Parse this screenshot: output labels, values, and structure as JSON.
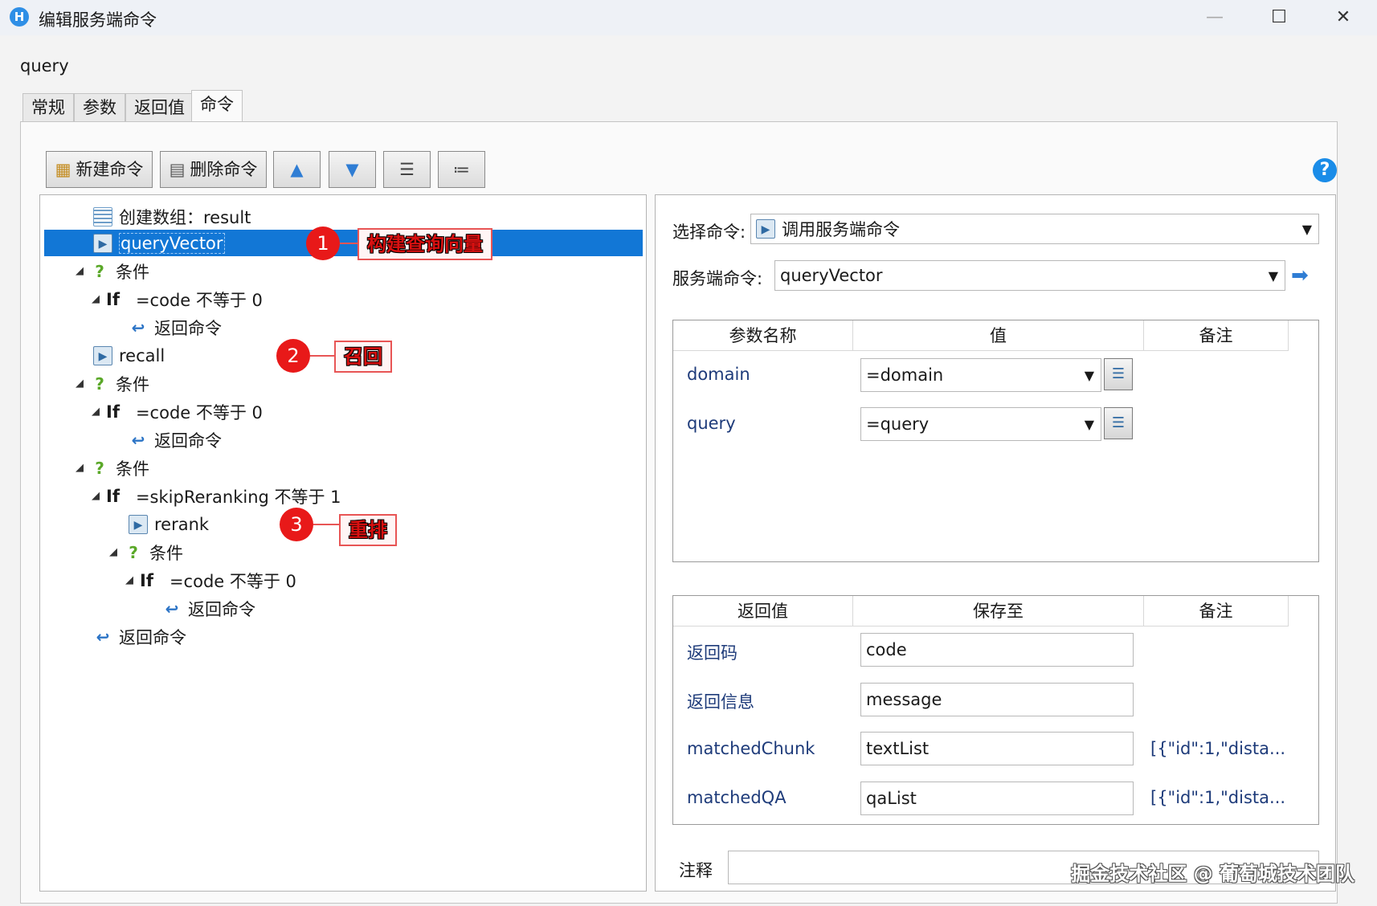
{
  "window": {
    "title": "编辑服务端命令",
    "minimize": "—",
    "maximize": "☐",
    "close": "✕"
  },
  "command_name": "query",
  "tabs": [
    "常规",
    "参数",
    "返回值",
    "命令"
  ],
  "toolbar": {
    "new_label": "新建命令",
    "delete_label": "删除命令"
  },
  "tree": [
    {
      "text": "创建数组：result"
    },
    {
      "text": "queryVector"
    },
    {
      "text": "条件"
    },
    {
      "text": "=code 不等于 0",
      "kw": "If"
    },
    {
      "text": "返回命令"
    },
    {
      "text": "recall"
    },
    {
      "text": "条件"
    },
    {
      "text": "=code 不等于 0",
      "kw": "If"
    },
    {
      "text": "返回命令"
    },
    {
      "text": "条件"
    },
    {
      "text": "=skipReranking 不等于 1",
      "kw": "If"
    },
    {
      "text": "rerank"
    },
    {
      "text": "条件"
    },
    {
      "text": "=code 不等于 0",
      "kw": "If"
    },
    {
      "text": "返回命令"
    },
    {
      "text": "返回命令"
    }
  ],
  "annotations": [
    {
      "num": "1",
      "label": "构建查询向量"
    },
    {
      "num": "2",
      "label": "召回"
    },
    {
      "num": "3",
      "label": "重排"
    }
  ],
  "right": {
    "select_label": "选择命令:",
    "select_value": "调用服务端命令",
    "server_label": "服务端命令:",
    "server_value": "queryVector",
    "params": {
      "headers": [
        "参数名称",
        "值",
        "备注"
      ],
      "rows": [
        {
          "name": "domain",
          "value": "=domain"
        },
        {
          "name": "query",
          "value": "=query"
        }
      ]
    },
    "returns": {
      "headers": [
        "返回值",
        "保存至",
        "备注"
      ],
      "rows": [
        {
          "name": "返回码",
          "save": "code",
          "note": ""
        },
        {
          "name": "返回信息",
          "save": "message",
          "note": ""
        },
        {
          "name": "matchedChunk",
          "save": "textList",
          "note": "[{\"id\":1,\"dista..."
        },
        {
          "name": "matchedQA",
          "save": "qaList",
          "note": "[{\"id\":1,\"dista..."
        }
      ]
    },
    "comment_label": "注释"
  },
  "watermark": "掘金技术社区 @ 葡萄城技术团队"
}
